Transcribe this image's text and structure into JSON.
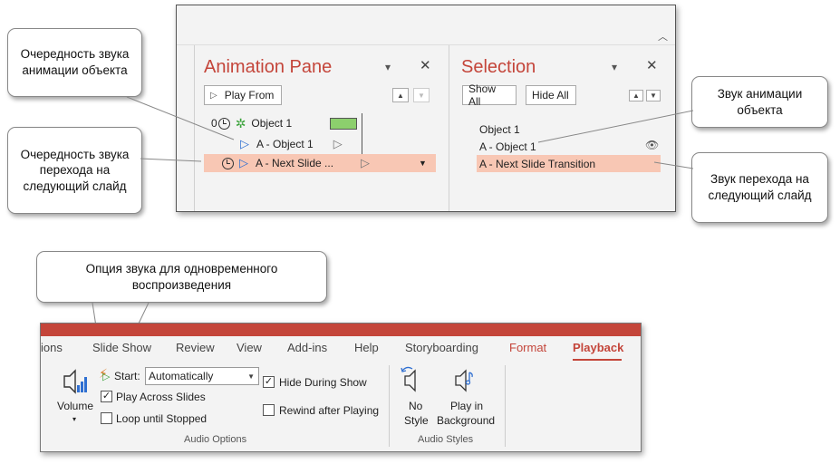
{
  "animation_pane": {
    "title": "Animation Pane",
    "play_from": "Play From",
    "rows": [
      {
        "order": "0",
        "label": "Object 1"
      },
      {
        "label": "A - Object 1"
      },
      {
        "label": "A - Next Slide ..."
      }
    ]
  },
  "selection_pane": {
    "title": "Selection",
    "show_all": "Show All",
    "hide_all": "Hide All",
    "items": [
      "Object 1",
      "A - Object 1",
      "A - Next Slide Transition"
    ]
  },
  "callouts": {
    "anim_order": "Очередность звука анимации объекта",
    "transition_order": "Очередность звука перехода на следующий слайд",
    "anim_sound": "Звук анимации объекта",
    "transition_sound": "Звук перехода на следующий слайд",
    "simultaneous": "Опция звука для одновременного воспроизведения"
  },
  "ribbon": {
    "tabs": [
      "ions",
      "Slide Show",
      "Review",
      "View",
      "Add-ins",
      "Help",
      "Storyboarding",
      "Format",
      "Playback"
    ],
    "volume_label": "Volume",
    "start_label": "Start:",
    "start_value": "Automatically",
    "play_across_slides": "Play Across Slides",
    "loop_until_stopped": "Loop until Stopped",
    "hide_during_show": "Hide During Show",
    "rewind_after_playing": "Rewind after Playing",
    "audio_options_label": "Audio Options",
    "no_style_l1": "No",
    "no_style_l2": "Style",
    "play_bg_l1": "Play in",
    "play_bg_l2": "Background",
    "audio_styles_label": "Audio Styles"
  },
  "colors": {
    "accent": "#c4453a",
    "highlight": "#f8c7b4",
    "green_bar": "#8ccf6d",
    "trigger_blue": "#2f6fd1"
  }
}
